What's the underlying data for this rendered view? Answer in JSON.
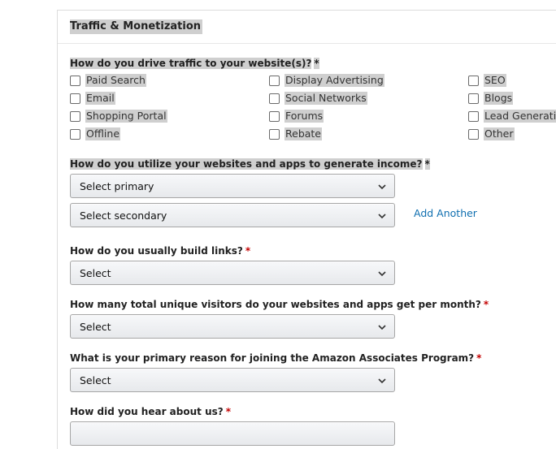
{
  "section": {
    "title": "Traffic & Monetization"
  },
  "traffic": {
    "question": "How do you drive traffic to your website(s)?",
    "required": "*",
    "options": [
      [
        "Paid Search",
        "Display Advertising",
        "SEO"
      ],
      [
        "Email",
        "Social Networks",
        "Blogs"
      ],
      [
        "Shopping Portal",
        "Forums",
        "Lead Generatio"
      ],
      [
        "Offline",
        "Rebate",
        "Other"
      ]
    ]
  },
  "income": {
    "question": "How do you utilize your websites and apps to generate income?",
    "required": "*",
    "primary_value": "Select primary",
    "secondary_value": "Select secondary",
    "add_another": "Add Another"
  },
  "links": {
    "question": "How do you usually build links?",
    "required": "*",
    "value": "Select"
  },
  "visitors": {
    "question": "How many total unique visitors do your websites and apps get per month?",
    "required": "*",
    "value": "Select"
  },
  "reason": {
    "question": "What is your primary reason for joining the Amazon Associates Program?",
    "required": "*",
    "value": "Select"
  },
  "hear": {
    "question": "How did you hear about us?",
    "required": "*"
  },
  "colors": {
    "required": "#c40000",
    "link": "#0f6fb0",
    "highlight": "#cfcfcf"
  }
}
